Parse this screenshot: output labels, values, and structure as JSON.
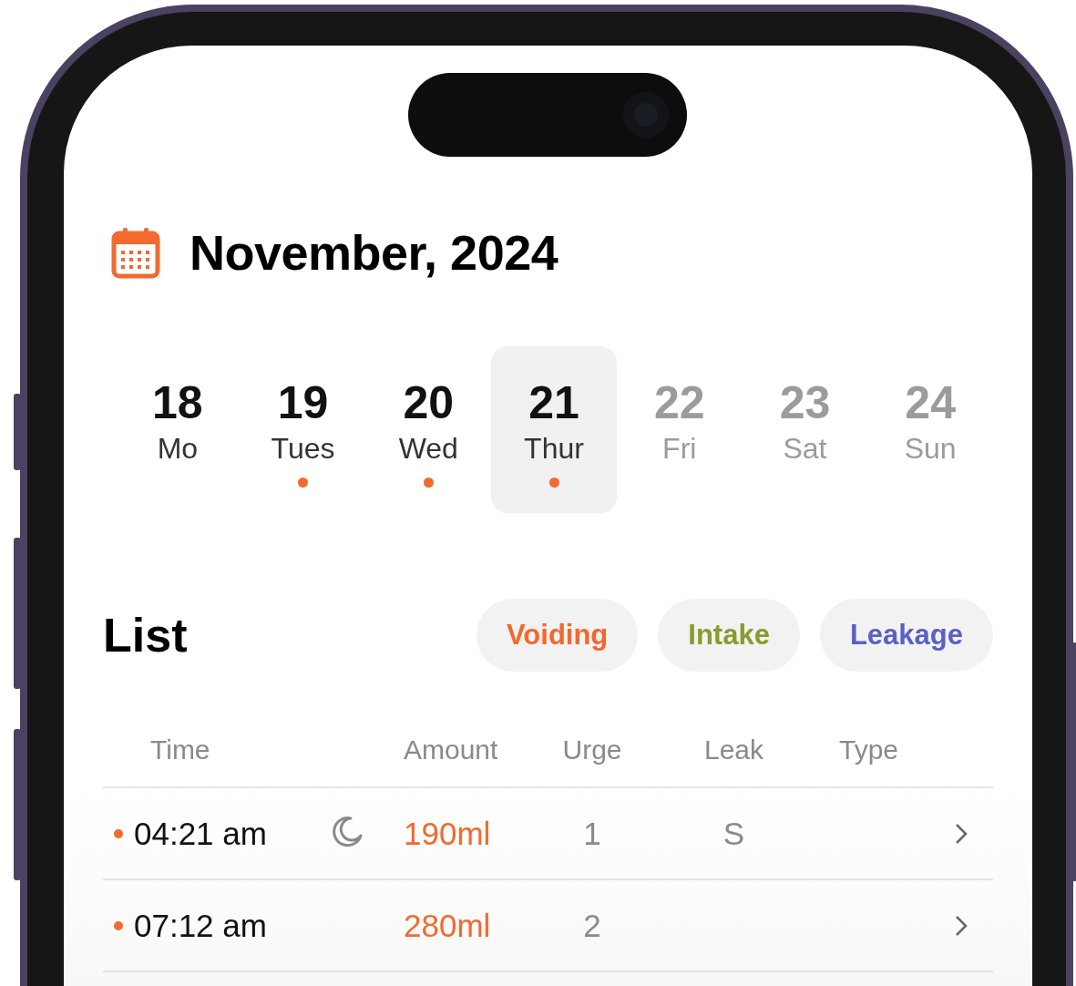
{
  "header": {
    "title": "November, 2024"
  },
  "days": [
    {
      "number": "18",
      "label": "Mo",
      "selected": false,
      "has_entry": false,
      "disabled": false
    },
    {
      "number": "19",
      "label": "Tues",
      "selected": false,
      "has_entry": true,
      "disabled": false
    },
    {
      "number": "20",
      "label": "Wed",
      "selected": false,
      "has_entry": true,
      "disabled": false
    },
    {
      "number": "21",
      "label": "Thur",
      "selected": true,
      "has_entry": true,
      "disabled": false
    },
    {
      "number": "22",
      "label": "Fri",
      "selected": false,
      "has_entry": false,
      "disabled": true
    },
    {
      "number": "23",
      "label": "Sat",
      "selected": false,
      "has_entry": false,
      "disabled": true
    },
    {
      "number": "24",
      "label": "Sun",
      "selected": false,
      "has_entry": false,
      "disabled": true
    }
  ],
  "list": {
    "title": "List",
    "filters": [
      {
        "label": "Voiding",
        "color": "#f2672e"
      },
      {
        "label": "Intake",
        "color": "#8b9a2c"
      },
      {
        "label": "Leakage",
        "color": "#5b5fc7"
      }
    ],
    "columns": [
      "Time",
      "Amount",
      "Urge",
      "Leak",
      "Type"
    ],
    "rows": [
      {
        "time": "04:21 am",
        "night": true,
        "amount": "190ml",
        "urge": "1",
        "leak": "S"
      },
      {
        "time": "07:12 am",
        "night": false,
        "amount": "280ml",
        "urge": "2"
      }
    ]
  }
}
